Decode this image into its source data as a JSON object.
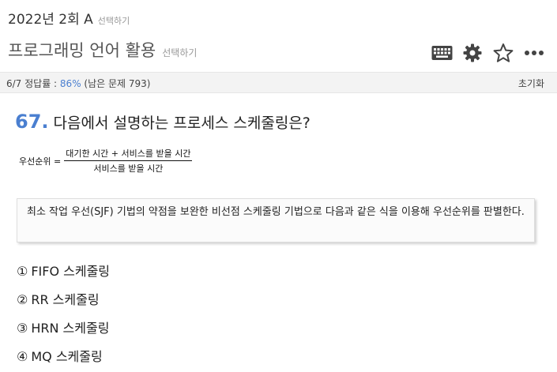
{
  "header": {
    "exam_title": "2022년 2회 A",
    "exam_select": "선택하기",
    "subject_title": "프로그래밍 언어 활용",
    "subject_select": "선택하기"
  },
  "toolbar": {
    "icons": [
      "keyboard-icon",
      "gear-icon",
      "star-icon",
      "more-icon"
    ]
  },
  "status": {
    "progress": "6/7 정답률 : ",
    "rate": "86%",
    "remaining": " (남은 문제 793)",
    "reset": "초기화"
  },
  "question": {
    "number": "67.",
    "text": "다음에서 설명하는 프로세스 스케줄링은?",
    "formula": {
      "lhs": "우선순위 =",
      "numerator": "대기한 시간 + 서비스를 받을 시간",
      "denominator": "서비스를 받을 시간"
    },
    "explanation": "최소 작업 우선(SJF) 기법의 약점을 보완한 비선점 스케줄링 기법으로 다음과 같은 식을 이용해 우선순위를 판별한다."
  },
  "choices": [
    {
      "mark": "①",
      "label": "FIFO 스케줄링"
    },
    {
      "mark": "②",
      "label": "RR 스케줄링"
    },
    {
      "mark": "③",
      "label": "HRN 스케줄링"
    },
    {
      "mark": "④",
      "label": "MQ 스케줄링"
    }
  ],
  "colors": {
    "accent": "#4a7fd0",
    "icon": "#444444"
  }
}
